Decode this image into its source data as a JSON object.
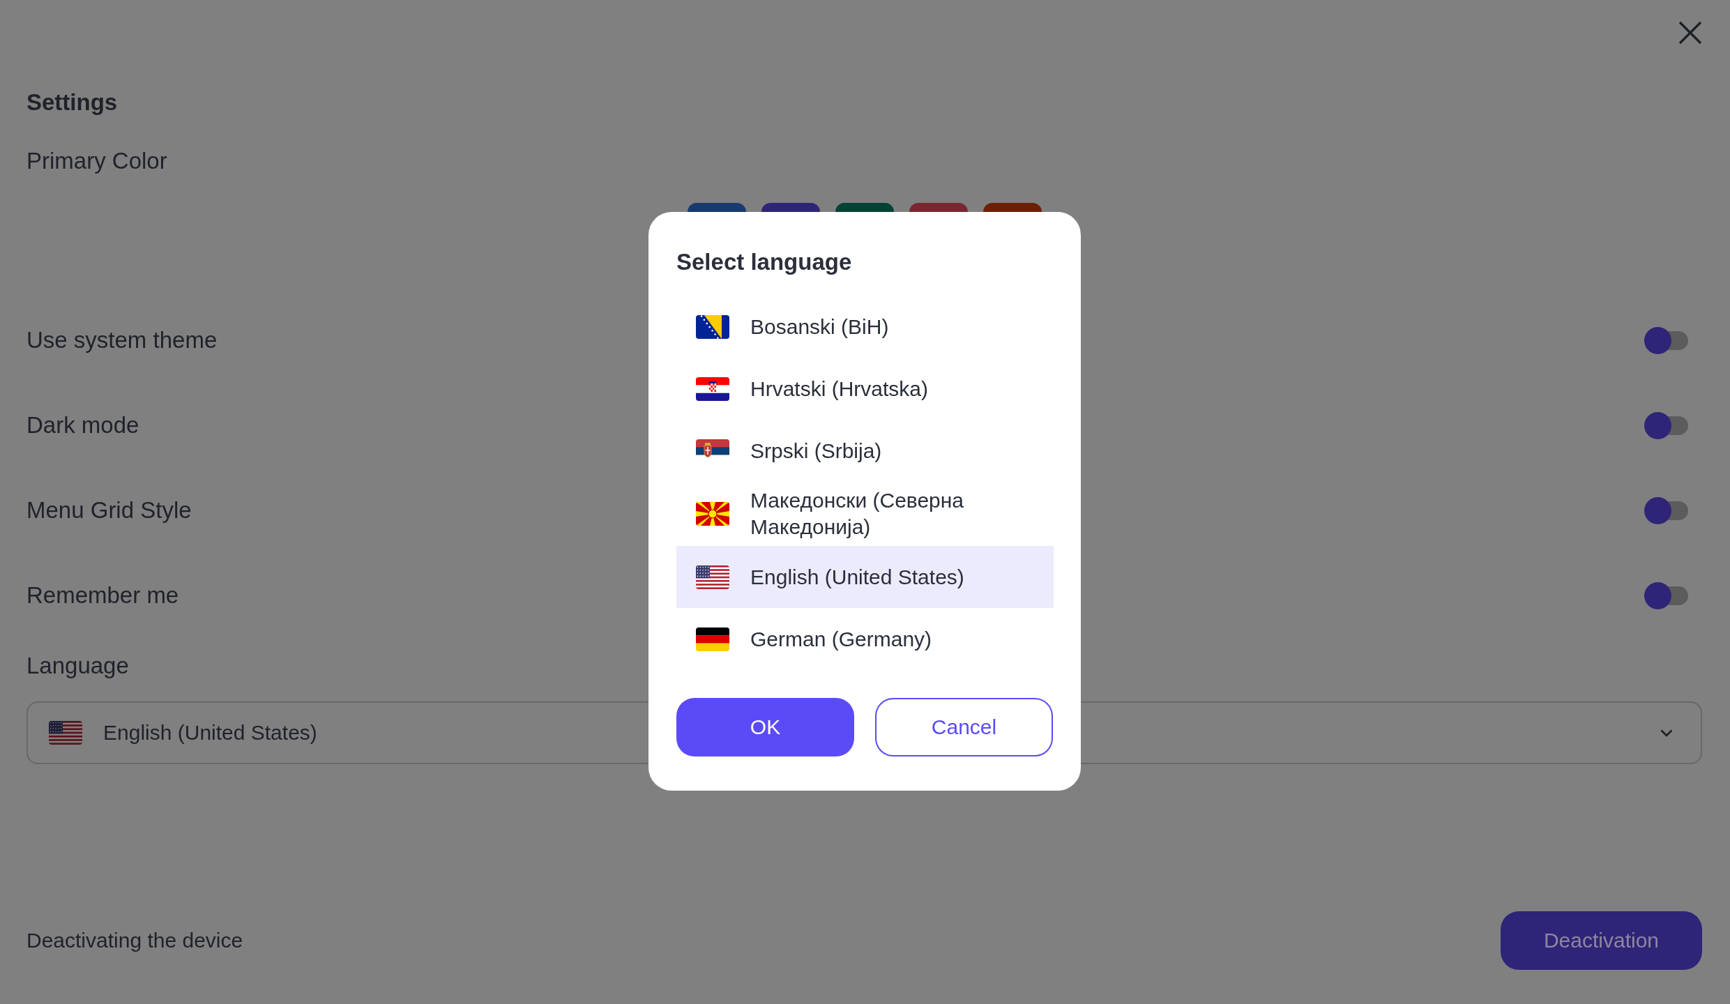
{
  "title": "Settings",
  "primary_color": {
    "label": "Primary Color",
    "swatches": [
      {
        "color": "#173a70"
      },
      {
        "color": "#2e2478"
      },
      {
        "color": "#044234"
      },
      {
        "color": "#7a2630"
      },
      {
        "color": "#6b1f05"
      }
    ]
  },
  "toggles": [
    {
      "label": "Use system theme",
      "on": false
    },
    {
      "label": "Dark mode",
      "on": false
    },
    {
      "label": "Menu Grid Style",
      "on": false
    },
    {
      "label": "Remember me",
      "on": false
    }
  ],
  "language": {
    "label": "Language",
    "value": "English (United States)"
  },
  "deactivation": {
    "text": "Deactivating the device",
    "button": "Deactivation"
  },
  "language_dialog": {
    "title": "Select language",
    "options": [
      {
        "label": "Bosanski (BiH)",
        "selected": false
      },
      {
        "label": "Hrvatski (Hrvatska)",
        "selected": false
      },
      {
        "label": "Srpski (Srbija)",
        "selected": false
      },
      {
        "label": "Македонски (Северна Македонија)",
        "selected": false
      },
      {
        "label": "English (United States)",
        "selected": true
      },
      {
        "label": "German (Germany)",
        "selected": false
      }
    ],
    "buttons": [
      {
        "label": "OK",
        "kind": "primary"
      },
      {
        "label": "Cancel",
        "kind": "outline"
      }
    ]
  }
}
